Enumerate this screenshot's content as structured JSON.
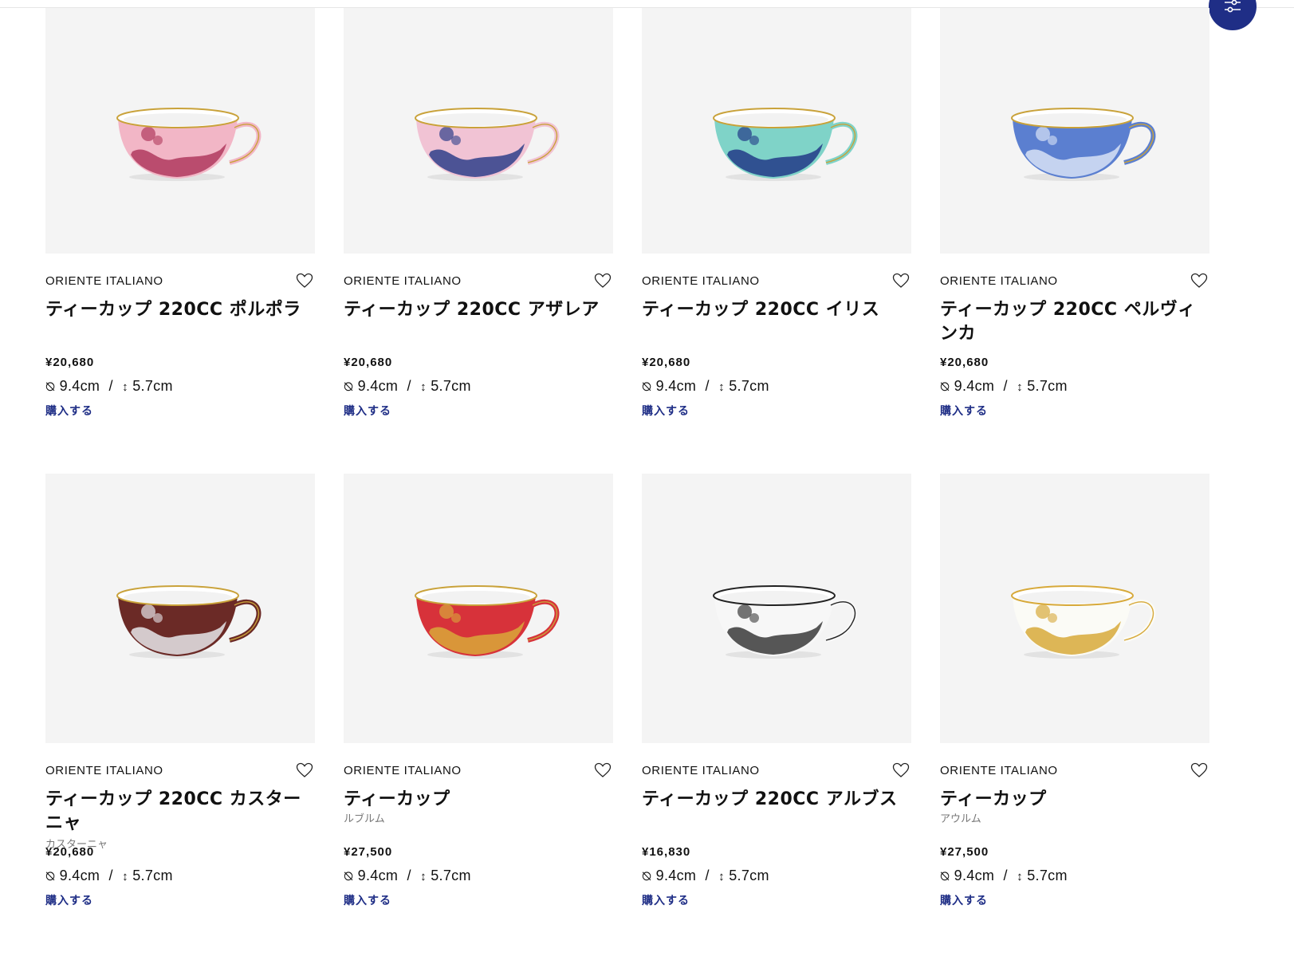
{
  "colors": {
    "accent": "#1f2e86",
    "image_bg": "#f4f4f4"
  },
  "filter_button": {
    "icon": "sliders-icon"
  },
  "buy_label": "購入する",
  "dims_separator": "/",
  "products": [
    {
      "brand": "ORIENTE ITALIANO",
      "title": "ティーカップ 220CC ポルポラ",
      "subtitle": "",
      "price": "¥20,680",
      "diameter": "9.4cm",
      "height": "5.7cm",
      "body_color": "#f2b6c6",
      "pattern_color": "#b03a5e",
      "rim": "#c9a23a"
    },
    {
      "brand": "ORIENTE ITALIANO",
      "title": "ティーカップ 220CC アザレア",
      "subtitle": "",
      "price": "¥20,680",
      "diameter": "9.4cm",
      "height": "5.7cm",
      "body_color": "#f1c3d4",
      "pattern_color": "#2f3f8a",
      "rim": "#c9a23a"
    },
    {
      "brand": "ORIENTE ITALIANO",
      "title": "ティーカップ 220CC イリス",
      "subtitle": "",
      "price": "¥20,680",
      "diameter": "9.4cm",
      "height": "5.7cm",
      "body_color": "#7fd3c8",
      "pattern_color": "#223a87",
      "rim": "#c9a23a"
    },
    {
      "brand": "ORIENTE ITALIANO",
      "title": "ティーカップ 220CC ペルヴィンカ",
      "subtitle": "",
      "price": "¥20,680",
      "diameter": "9.4cm",
      "height": "5.7cm",
      "body_color": "#5b7fd0",
      "pattern_color": "#d8e2f6",
      "rim": "#c9a23a"
    },
    {
      "brand": "ORIENTE ITALIANO",
      "title": "ティーカップ 220CC カスターニャ",
      "subtitle": "カスターニャ",
      "price": "¥20,680",
      "diameter": "9.4cm",
      "height": "5.7cm",
      "body_color": "#6b2a26",
      "pattern_color": "#e6e6ea",
      "rim": "#c9a23a"
    },
    {
      "brand": "ORIENTE ITALIANO",
      "title": "ティーカップ",
      "subtitle": "ルブルム",
      "price": "¥27,500",
      "diameter": "9.4cm",
      "height": "5.7cm",
      "body_color": "#d7323a",
      "pattern_color": "#d9a83a",
      "rim": "#c9a23a"
    },
    {
      "brand": "ORIENTE ITALIANO",
      "title": "ティーカップ 220CC アルブス",
      "subtitle": "",
      "price": "¥16,830",
      "diameter": "9.4cm",
      "height": "5.7cm",
      "body_color": "#f7f7f7",
      "pattern_color": "#3a3a3a",
      "rim": "#222222"
    },
    {
      "brand": "ORIENTE ITALIANO",
      "title": "ティーカップ",
      "subtitle": "アウルム",
      "price": "¥27,500",
      "diameter": "9.4cm",
      "height": "5.7cm",
      "body_color": "#fbfbf6",
      "pattern_color": "#d7a93a",
      "rim": "#d7a93a"
    }
  ]
}
